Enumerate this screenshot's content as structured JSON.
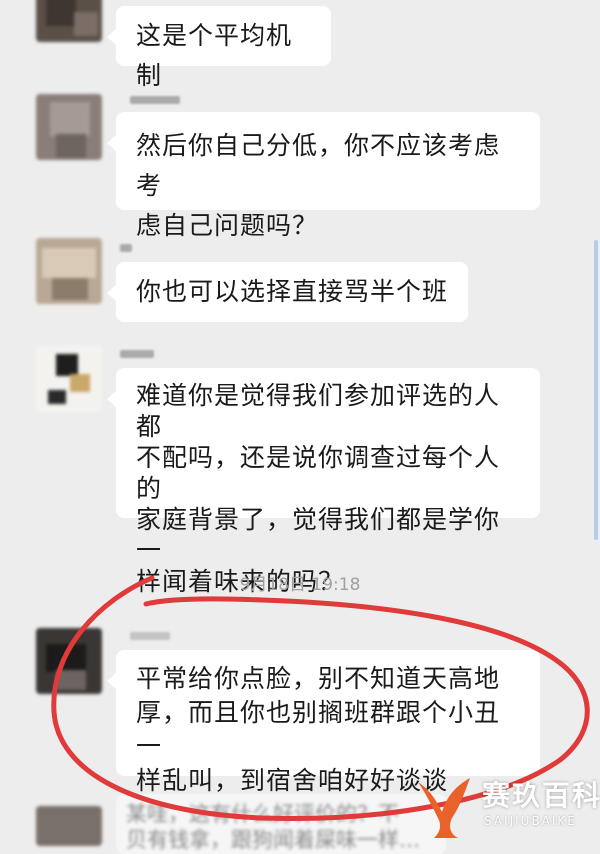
{
  "messages": [
    {
      "lines": [
        "这是个平均机制"
      ]
    },
    {
      "lines": [
        "然后你自己分低，你不应该考虑考",
        "虑自己问题吗？"
      ]
    },
    {
      "lines": [
        "你也可以选择直接骂半个班"
      ]
    },
    {
      "lines": [
        "难道你是觉得我们参加评选的人都",
        "不配吗，还是说你调查过每个人的",
        "家庭背景了，觉得我们都是学你一",
        "样闻着味来的吗？"
      ]
    },
    {
      "lines": [
        "平常给你点脸，别不知道天高地",
        "厚，而且你也别搁班群跟个小丑一",
        "样乱叫，到宿舍咱好好谈谈"
      ]
    }
  ],
  "timestamp": "9月18日 19:18",
  "partial_message": {
    "lines": [
      "某哇，这有什么好评价的？不",
      "贝有钱拿，跟狗闻着屎味一样…"
    ]
  },
  "watermark": {
    "text": "赛玖百科",
    "sub": "SAIJIUBAIKE"
  },
  "colors": {
    "background": "#ededed",
    "bubble": "#ffffff",
    "highlight_circle": "#e03a3a",
    "watermark": "#e9622b"
  }
}
